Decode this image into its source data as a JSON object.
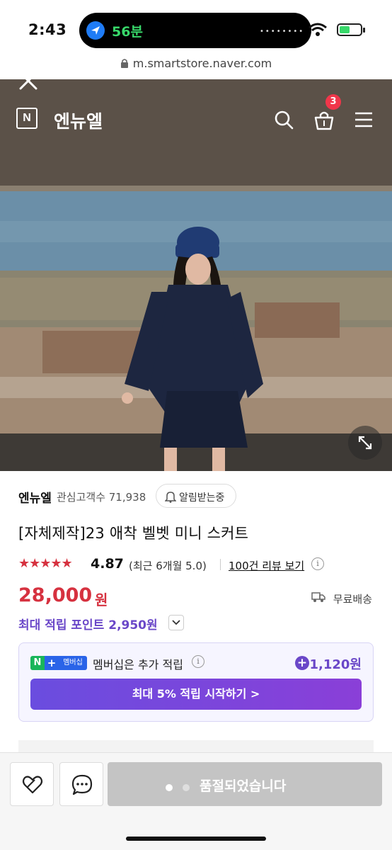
{
  "status_bar": {
    "time": "2:43",
    "nav_text": "56분",
    "dots": "••••••••",
    "battery_level": 0.5
  },
  "browser": {
    "url": "m.smartstore.naver.com"
  },
  "store_header": {
    "logo_letter": "N",
    "store_name": "엔뉴엘",
    "cart_count": "3"
  },
  "seller": {
    "name": "엔뉴엘",
    "followers": "관심고객수 71,938",
    "follow_label": "알림받는중"
  },
  "product": {
    "title": "[자체제작]23 애착 벨벳 미니 스커트",
    "stars": "★★★★★",
    "rating": "4.87",
    "rating_recent": "(최근 6개월 5.0)",
    "review_link": "100건 리뷰 보기",
    "price": "28,000",
    "price_unit": "원",
    "shipping": "무료배송",
    "max_points": "최대 적립 포인트 2,950원"
  },
  "membership": {
    "badge_n": "N",
    "badge_plus": "+",
    "badge_text": "멤버십",
    "text": "멤버십은 추가 적립",
    "points": "1,120원",
    "cta": "최대 5% 적립 시작하기 >"
  },
  "bottom": {
    "soldout_label": "품절되었습니다"
  },
  "colors": {
    "accent_red": "#d6313f",
    "accent_purple": "#6a47c8",
    "header_brown": "#5b5148",
    "naver_green": "#19b55a"
  },
  "icons": [
    "close-icon",
    "n-logo-icon",
    "search-icon",
    "cart-icon",
    "menu-icon",
    "expand-icon",
    "bell-icon",
    "info-icon",
    "truck-icon",
    "chevron-down-icon",
    "plus-circle-icon",
    "heart-icon",
    "chat-icon"
  ]
}
